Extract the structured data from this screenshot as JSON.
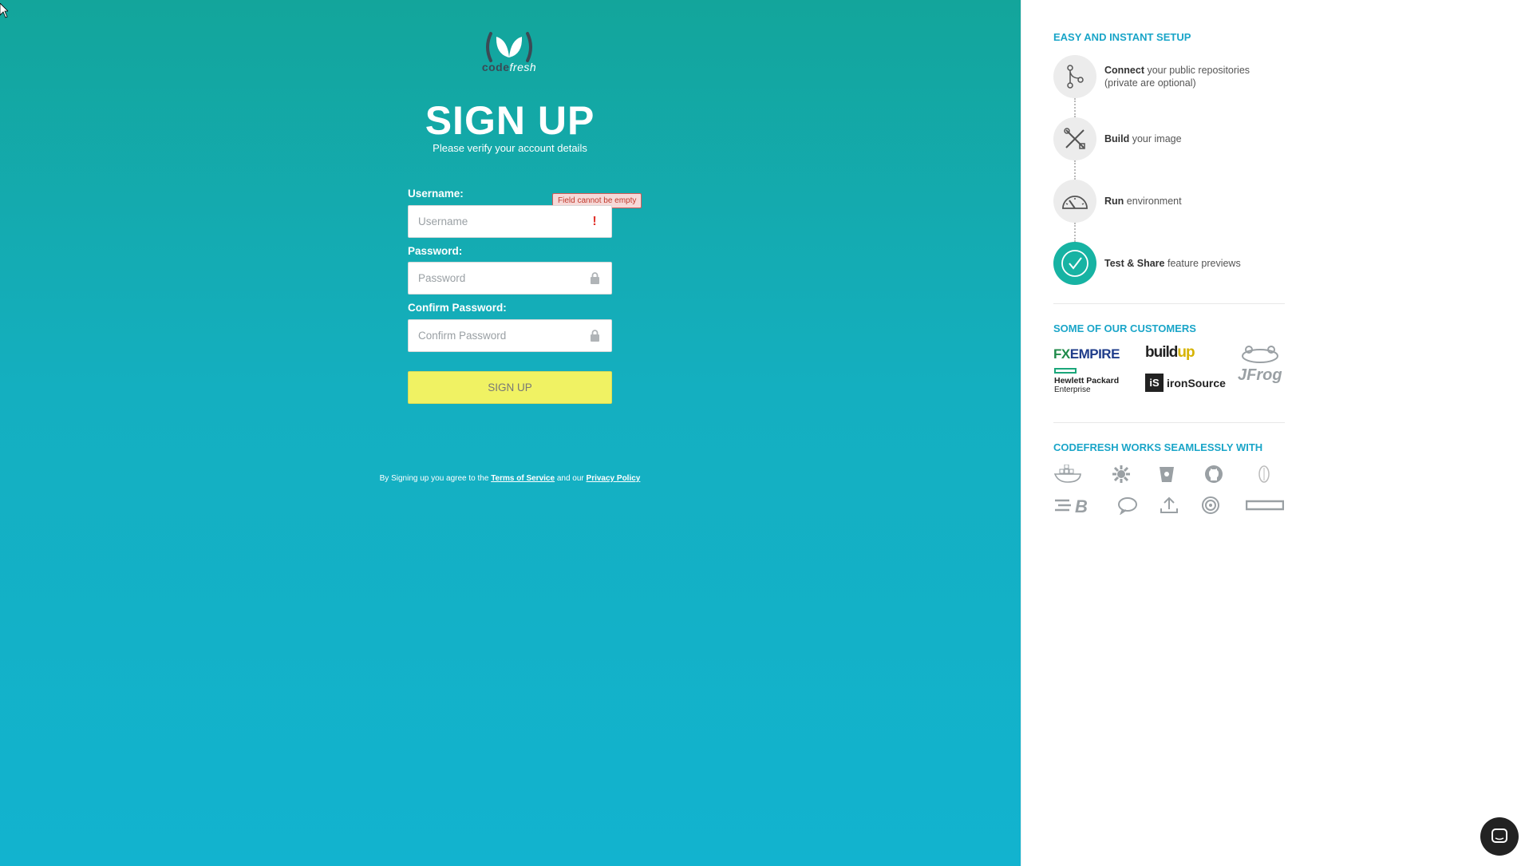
{
  "signup": {
    "logo_text_code": "code",
    "logo_text_fresh": "fresh",
    "title": "SIGN UP",
    "subtitle": "Please verify your account details",
    "username_label": "Username:",
    "username_placeholder": "Username",
    "username_error": "Field cannot be empty",
    "password_label": "Password:",
    "password_placeholder": "Password",
    "confirm_label": "Confirm Password:",
    "confirm_placeholder": "Confirm Password",
    "submit_label": "SIGN UP",
    "terms_prefix": "By Signing up you agree to the",
    "terms_link": "Terms of Service",
    "terms_mid": "and our",
    "privacy_link": "Privacy Policy"
  },
  "setup": {
    "title": "EASY AND INSTANT SETUP",
    "steps": [
      {
        "bold": "Connect",
        "rest": "your public repositories",
        "line2": "(private are optional)",
        "icon": "git-branch-icon"
      },
      {
        "bold": "Build",
        "rest": "your image",
        "line2": "",
        "icon": "tools-icon"
      },
      {
        "bold": "Run",
        "rest": "environment",
        "line2": "",
        "icon": "speedometer-icon"
      },
      {
        "bold": "Test & Share",
        "rest": "feature previews",
        "line2": "",
        "icon": "check-icon"
      }
    ]
  },
  "customers": {
    "title": "SOME OF OUR CUSTOMERS",
    "fx_a": "FX",
    "fx_b": "EMPIRE",
    "buildup_a": "build",
    "buildup_b": "up",
    "hpe_line1": "Hewlett Packard",
    "hpe_line2": "Enterprise",
    "ironsource_mark": "iS",
    "ironsource": "ironSource",
    "jfrog": "JFrog"
  },
  "integrations": {
    "title": "CODEFRESH WORKS SEAMLESSLY WITH",
    "icons": [
      "docker-icon",
      "kubernetes-icon",
      "bucket-icon",
      "github-icon",
      "gitlab-icon",
      "bitbucket-icon",
      "chat-icon",
      "upload-icon",
      "target-icon",
      "rectangle-icon"
    ]
  },
  "colors": {
    "accent": "#1aa5c8",
    "button": "#f0f263",
    "teal": "#17b3a3",
    "error": "#e0322b"
  }
}
